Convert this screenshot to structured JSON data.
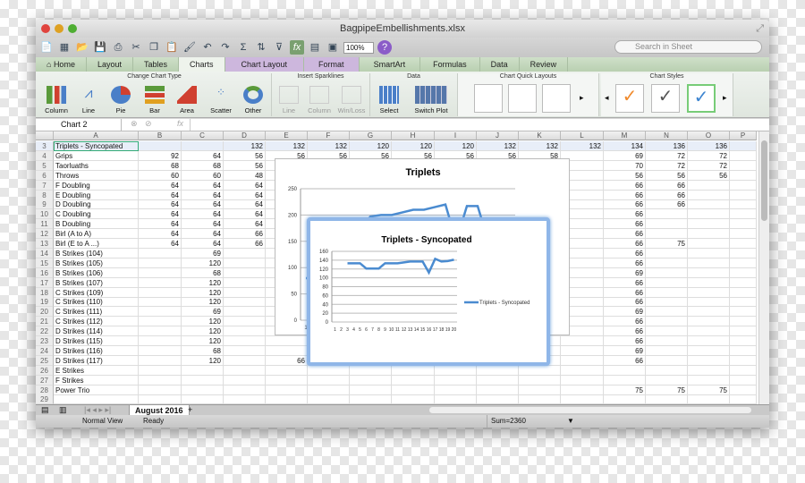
{
  "window": {
    "title": "BagpipeEmbellishments.xlsx"
  },
  "toolbar": {
    "zoom": "100%",
    "search_placeholder": "Search in Sheet"
  },
  "tabs": [
    "Home",
    "Layout",
    "Tables",
    "Charts",
    "Chart Layout",
    "Format",
    "SmartArt",
    "Formulas",
    "Data",
    "Review"
  ],
  "active_tab": "Charts",
  "ribbon": {
    "groups": {
      "change_chart_type": "Change Chart Type",
      "insert_sparklines": "Insert Sparklines",
      "data": "Data",
      "quick_layouts": "Chart Quick Layouts",
      "styles": "Chart Styles"
    },
    "chart_types": [
      "Column",
      "Line",
      "Pie",
      "Bar",
      "Area",
      "Scatter",
      "Other"
    ],
    "sparklines": [
      "Line",
      "Column",
      "Win/Loss"
    ],
    "data_buttons": [
      "Select",
      "Switch Plot"
    ],
    "style_colors": [
      "#f08a2c",
      "#555555",
      "#3c84d0"
    ]
  },
  "formula_bar": {
    "name_box": "Chart 2",
    "fx": "fx",
    "value": ""
  },
  "columns": [
    "A",
    "B",
    "C",
    "D",
    "E",
    "F",
    "G",
    "H",
    "I",
    "J",
    "K",
    "L",
    "M",
    "N",
    "O",
    "P"
  ],
  "rows": [
    {
      "n": "3",
      "c": [
        "Triplets - Syncopated",
        "",
        "",
        "132",
        "132",
        "132",
        "120",
        "120",
        "120",
        "132",
        "132",
        "132",
        "134",
        "136",
        "136"
      ]
    },
    {
      "n": "4",
      "c": [
        "Grips",
        "92",
        "64",
        "56",
        "56",
        "56",
        "56",
        "56",
        "56",
        "56",
        "58",
        "",
        "69",
        "72",
        "72"
      ]
    },
    {
      "n": "5",
      "c": [
        "Taorluaths",
        "68",
        "68",
        "56",
        "",
        "",
        "",
        "",
        "",
        "",
        "",
        "",
        "70",
        "72",
        "72"
      ]
    },
    {
      "n": "6",
      "c": [
        "Throws",
        "60",
        "60",
        "48",
        "",
        "",
        "",
        "",
        "",
        "",
        "",
        "",
        "56",
        "56",
        "56"
      ]
    },
    {
      "n": "7",
      "c": [
        "F Doubling",
        "64",
        "64",
        "64",
        "",
        "",
        "",
        "",
        "",
        "",
        "",
        "",
        "66",
        "66",
        ""
      ]
    },
    {
      "n": "8",
      "c": [
        "E Doubling",
        "64",
        "64",
        "64",
        "",
        "",
        "",
        "",
        "",
        "",
        "",
        "",
        "66",
        "66",
        ""
      ]
    },
    {
      "n": "9",
      "c": [
        "D Doubling",
        "64",
        "64",
        "64",
        "",
        "",
        "",
        "",
        "",
        "",
        "",
        "",
        "66",
        "66",
        ""
      ]
    },
    {
      "n": "10",
      "c": [
        "C Doubling",
        "64",
        "64",
        "64",
        "",
        "",
        "",
        "",
        "",
        "",
        "",
        "",
        "66",
        "",
        ""
      ]
    },
    {
      "n": "11",
      "c": [
        "B Doubling",
        "64",
        "64",
        "64",
        "",
        "",
        "",
        "",
        "",
        "",
        "",
        "",
        "66",
        "",
        ""
      ]
    },
    {
      "n": "12",
      "c": [
        "Birl (A to A)",
        "64",
        "64",
        "66",
        "",
        "",
        "",
        "",
        "",
        "",
        "",
        "",
        "66",
        "",
        ""
      ]
    },
    {
      "n": "13",
      "c": [
        "Birl (E to A ...)",
        "64",
        "64",
        "66",
        "",
        "",
        "",
        "",
        "",
        "",
        "",
        "",
        "66",
        "75",
        ""
      ]
    },
    {
      "n": "14",
      "c": [
        "B Strikes (104)",
        "",
        "69",
        "",
        "",
        "",
        "",
        "",
        "",
        "",
        "",
        "",
        "66",
        "",
        ""
      ]
    },
    {
      "n": "15",
      "c": [
        "B Strikes (105)",
        "",
        "120",
        "",
        "",
        "",
        "",
        "",
        "",
        "",
        "",
        "",
        "66",
        "",
        ""
      ]
    },
    {
      "n": "16",
      "c": [
        "B Strikes (106)",
        "",
        "68",
        "",
        "",
        "",
        "",
        "",
        "",
        "",
        "",
        "",
        "69",
        "",
        ""
      ]
    },
    {
      "n": "17",
      "c": [
        "B Strikes (107)",
        "",
        "120",
        "",
        "",
        "",
        "",
        "",
        "",
        "",
        "",
        "",
        "66",
        "",
        ""
      ]
    },
    {
      "n": "18",
      "c": [
        "C Strikes (109)",
        "",
        "120",
        "",
        "",
        "",
        "",
        "",
        "",
        "",
        "",
        "",
        "66",
        "",
        ""
      ]
    },
    {
      "n": "19",
      "c": [
        "C Strikes (110)",
        "",
        "120",
        "",
        "",
        "",
        "",
        "",
        "",
        "",
        "",
        "",
        "66",
        "",
        ""
      ]
    },
    {
      "n": "20",
      "c": [
        "C Strikes (111)",
        "",
        "69",
        "",
        "",
        "",
        "",
        "",
        "",
        "",
        "",
        "",
        "69",
        "",
        ""
      ]
    },
    {
      "n": "21",
      "c": [
        "C Strikes (112)",
        "",
        "120",
        "",
        "",
        "",
        "",
        "",
        "",
        "",
        "",
        "",
        "66",
        "",
        ""
      ]
    },
    {
      "n": "22",
      "c": [
        "D Strikes (114)",
        "",
        "120",
        "",
        "",
        "",
        "",
        "",
        "",
        "",
        "",
        "",
        "66",
        "",
        ""
      ]
    },
    {
      "n": "23",
      "c": [
        "D Strikes (115)",
        "",
        "120",
        "",
        "",
        "",
        "",
        "",
        "",
        "",
        "",
        "",
        "66",
        "",
        ""
      ]
    },
    {
      "n": "24",
      "c": [
        "D Strikes (116)",
        "",
        "68",
        "",
        "",
        "",
        "",
        "",
        "",
        "",
        "",
        "",
        "69",
        "",
        ""
      ]
    },
    {
      "n": "25",
      "c": [
        "D Strikes (117)",
        "",
        "120",
        "",
        "66",
        "",
        "",
        "",
        "",
        "",
        "",
        "",
        "66",
        "",
        ""
      ]
    },
    {
      "n": "26",
      "c": [
        "E Strikes",
        "",
        "",
        "",
        "",
        "",
        "",
        "",
        "",
        "",
        "",
        "",
        "",
        "",
        ""
      ]
    },
    {
      "n": "27",
      "c": [
        "F Strikes",
        "",
        "",
        "",
        "",
        "",
        "",
        "",
        "",
        "",
        "",
        "",
        "",
        "",
        ""
      ]
    },
    {
      "n": "28",
      "c": [
        "Power Trio",
        "",
        "",
        "",
        "",
        "",
        "",
        "",
        "",
        "",
        "",
        "",
        "75",
        "75",
        "75"
      ]
    },
    {
      "n": "29",
      "c": [
        "",
        "",
        "",
        "",
        "",
        "",
        "",
        "",
        "",
        "",
        "",
        "",
        "",
        "",
        ""
      ]
    }
  ],
  "sheet_tabs": [
    "August 2016"
  ],
  "status": {
    "view": "Normal View",
    "state": "Ready",
    "sum": "Sum=2360"
  },
  "chart_data": [
    {
      "type": "line",
      "title": "Triplets",
      "legend": "Triplets",
      "ylim": [
        0,
        250
      ],
      "yticks": [
        "0",
        "50",
        "100",
        "150",
        "200",
        "250"
      ],
      "x": [
        1,
        2,
        3,
        4,
        5,
        6,
        7,
        8,
        9,
        10,
        11,
        12,
        13,
        14,
        15,
        16,
        17,
        18,
        19,
        20
      ],
      "values": [
        80,
        80,
        90,
        110,
        140,
        170,
        197,
        200,
        200,
        205,
        210,
        210,
        215,
        220,
        150,
        217,
        217,
        150,
        150,
        150
      ],
      "color": "#4a8bd0"
    },
    {
      "type": "line",
      "title": "Triplets - Syncopated",
      "legend": "Triplets - Syncopated",
      "ylim": [
        0,
        160
      ],
      "yticks": [
        "0",
        "20",
        "40",
        "60",
        "80",
        "100",
        "120",
        "140",
        "160"
      ],
      "x": [
        1,
        2,
        3,
        4,
        5,
        6,
        7,
        8,
        9,
        10,
        11,
        12,
        13,
        14,
        15,
        16,
        17,
        18,
        19,
        20
      ],
      "values": [
        null,
        null,
        133,
        133,
        133,
        121,
        121,
        121,
        133,
        133,
        133,
        135,
        137,
        137,
        137,
        112,
        143,
        137,
        138,
        141
      ],
      "color": "#4a8bd0"
    }
  ]
}
